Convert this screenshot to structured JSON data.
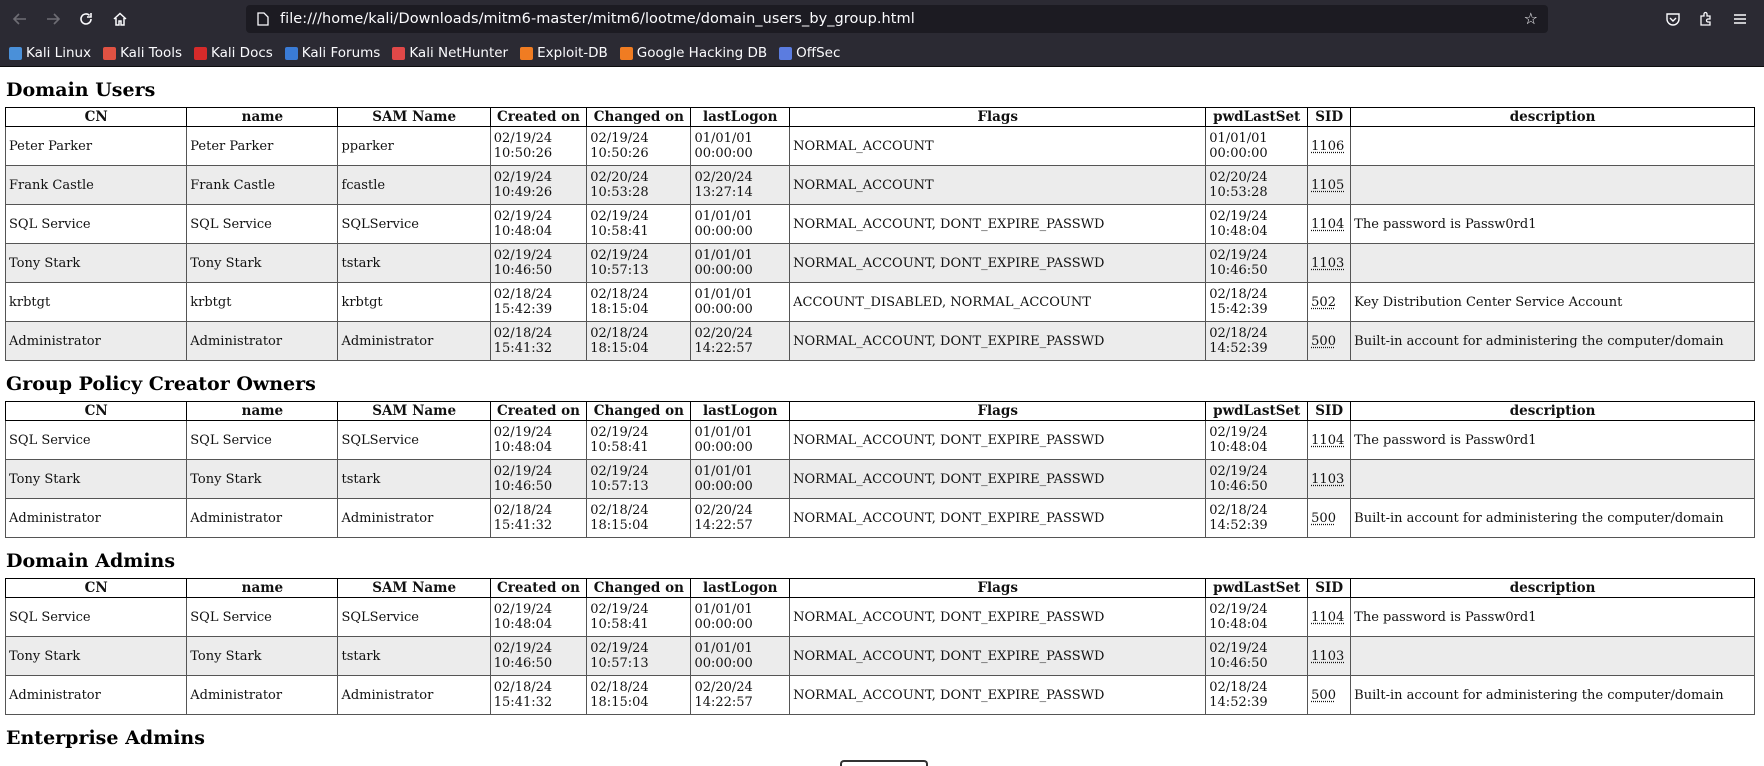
{
  "browser": {
    "url": "file:///home/kali/Downloads/mitm6-master/mitm6/lootme/domain_users_by_group.html",
    "bookmarks": [
      {
        "label": "Kali Linux",
        "color": "#4a90d9"
      },
      {
        "label": "Kali Tools",
        "color": "#e05243"
      },
      {
        "label": "Kali Docs",
        "color": "#d62a2a"
      },
      {
        "label": "Kali Forums",
        "color": "#3a7bd5"
      },
      {
        "label": "Kali NetHunter",
        "color": "#e04848"
      },
      {
        "label": "Exploit-DB",
        "color": "#f07c22"
      },
      {
        "label": "Google Hacking DB",
        "color": "#f07c22"
      },
      {
        "label": "OffSec",
        "color": "#5b7ce0"
      }
    ]
  },
  "columns": [
    "CN",
    "name",
    "SAM Name",
    "Created on",
    "Changed on",
    "lastLogon",
    "Flags",
    "pwdLastSet",
    "SID",
    "description"
  ],
  "sections": [
    {
      "title": "Domain Users",
      "rows": [
        {
          "cn": "Peter Parker",
          "name": "Peter Parker",
          "sam": "pparker",
          "created": [
            "02/19/24",
            "10:50:26"
          ],
          "changed": [
            "02/19/24",
            "10:50:26"
          ],
          "lastlogon": [
            "01/01/01",
            "00:00:00"
          ],
          "flags": "NORMAL_ACCOUNT",
          "pwdlastset": [
            "01/01/01",
            "00:00:00"
          ],
          "sid": "1106",
          "description": ""
        },
        {
          "cn": "Frank Castle",
          "name": "Frank Castle",
          "sam": "fcastle",
          "created": [
            "02/19/24",
            "10:49:26"
          ],
          "changed": [
            "02/20/24",
            "10:53:28"
          ],
          "lastlogon": [
            "02/20/24",
            "13:27:14"
          ],
          "flags": "NORMAL_ACCOUNT",
          "pwdlastset": [
            "02/20/24",
            "10:53:28"
          ],
          "sid": "1105",
          "description": ""
        },
        {
          "cn": "SQL Service",
          "name": "SQL Service",
          "sam": "SQLService",
          "created": [
            "02/19/24",
            "10:48:04"
          ],
          "changed": [
            "02/19/24",
            "10:58:41"
          ],
          "lastlogon": [
            "01/01/01",
            "00:00:00"
          ],
          "flags": "NORMAL_ACCOUNT, DONT_EXPIRE_PASSWD",
          "pwdlastset": [
            "02/19/24",
            "10:48:04"
          ],
          "sid": "1104",
          "description": "The password is Passw0rd1"
        },
        {
          "cn": "Tony Stark",
          "name": "Tony Stark",
          "sam": "tstark",
          "created": [
            "02/19/24",
            "10:46:50"
          ],
          "changed": [
            "02/19/24",
            "10:57:13"
          ],
          "lastlogon": [
            "01/01/01",
            "00:00:00"
          ],
          "flags": "NORMAL_ACCOUNT, DONT_EXPIRE_PASSWD",
          "pwdlastset": [
            "02/19/24",
            "10:46:50"
          ],
          "sid": "1103",
          "description": ""
        },
        {
          "cn": "krbtgt",
          "name": "krbtgt",
          "sam": "krbtgt",
          "created": [
            "02/18/24",
            "15:42:39"
          ],
          "changed": [
            "02/18/24",
            "18:15:04"
          ],
          "lastlogon": [
            "01/01/01",
            "00:00:00"
          ],
          "flags": "ACCOUNT_DISABLED, NORMAL_ACCOUNT",
          "pwdlastset": [
            "02/18/24",
            "15:42:39"
          ],
          "sid": "502",
          "description": "Key Distribution Center Service Account"
        },
        {
          "cn": "Administrator",
          "name": "Administrator",
          "sam": "Administrator",
          "created": [
            "02/18/24",
            "15:41:32"
          ],
          "changed": [
            "02/18/24",
            "18:15:04"
          ],
          "lastlogon": [
            "02/20/24",
            "14:22:57"
          ],
          "flags": "NORMAL_ACCOUNT, DONT_EXPIRE_PASSWD",
          "pwdlastset": [
            "02/18/24",
            "14:52:39"
          ],
          "sid": "500",
          "description": "Built-in account for administering the computer/domain"
        }
      ]
    },
    {
      "title": "Group Policy Creator Owners",
      "rows": [
        {
          "cn": "SQL Service",
          "name": "SQL Service",
          "sam": "SQLService",
          "created": [
            "02/19/24",
            "10:48:04"
          ],
          "changed": [
            "02/19/24",
            "10:58:41"
          ],
          "lastlogon": [
            "01/01/01",
            "00:00:00"
          ],
          "flags": "NORMAL_ACCOUNT, DONT_EXPIRE_PASSWD",
          "pwdlastset": [
            "02/19/24",
            "10:48:04"
          ],
          "sid": "1104",
          "description": "The password is Passw0rd1"
        },
        {
          "cn": "Tony Stark",
          "name": "Tony Stark",
          "sam": "tstark",
          "created": [
            "02/19/24",
            "10:46:50"
          ],
          "changed": [
            "02/19/24",
            "10:57:13"
          ],
          "lastlogon": [
            "01/01/01",
            "00:00:00"
          ],
          "flags": "NORMAL_ACCOUNT, DONT_EXPIRE_PASSWD",
          "pwdlastset": [
            "02/19/24",
            "10:46:50"
          ],
          "sid": "1103",
          "description": ""
        },
        {
          "cn": "Administrator",
          "name": "Administrator",
          "sam": "Administrator",
          "created": [
            "02/18/24",
            "15:41:32"
          ],
          "changed": [
            "02/18/24",
            "18:15:04"
          ],
          "lastlogon": [
            "02/20/24",
            "14:22:57"
          ],
          "flags": "NORMAL_ACCOUNT, DONT_EXPIRE_PASSWD",
          "pwdlastset": [
            "02/18/24",
            "14:52:39"
          ],
          "sid": "500",
          "description": "Built-in account for administering the computer/domain"
        }
      ]
    },
    {
      "title": "Domain Admins",
      "rows": [
        {
          "cn": "SQL Service",
          "name": "SQL Service",
          "sam": "SQLService",
          "created": [
            "02/19/24",
            "10:48:04"
          ],
          "changed": [
            "02/19/24",
            "10:58:41"
          ],
          "lastlogon": [
            "01/01/01",
            "00:00:00"
          ],
          "flags": "NORMAL_ACCOUNT, DONT_EXPIRE_PASSWD",
          "pwdlastset": [
            "02/19/24",
            "10:48:04"
          ],
          "sid": "1104",
          "description": "The password is Passw0rd1"
        },
        {
          "cn": "Tony Stark",
          "name": "Tony Stark",
          "sam": "tstark",
          "created": [
            "02/19/24",
            "10:46:50"
          ],
          "changed": [
            "02/19/24",
            "10:57:13"
          ],
          "lastlogon": [
            "01/01/01",
            "00:00:00"
          ],
          "flags": "NORMAL_ACCOUNT, DONT_EXPIRE_PASSWD",
          "pwdlastset": [
            "02/19/24",
            "10:46:50"
          ],
          "sid": "1103",
          "description": ""
        },
        {
          "cn": "Administrator",
          "name": "Administrator",
          "sam": "Administrator",
          "created": [
            "02/18/24",
            "15:41:32"
          ],
          "changed": [
            "02/18/24",
            "18:15:04"
          ],
          "lastlogon": [
            "02/20/24",
            "14:22:57"
          ],
          "flags": "NORMAL_ACCOUNT, DONT_EXPIRE_PASSWD",
          "pwdlastset": [
            "02/18/24",
            "14:52:39"
          ],
          "sid": "500",
          "description": "Built-in account for administering the computer/domain"
        }
      ]
    },
    {
      "title": "Enterprise Admins",
      "rows": []
    }
  ]
}
